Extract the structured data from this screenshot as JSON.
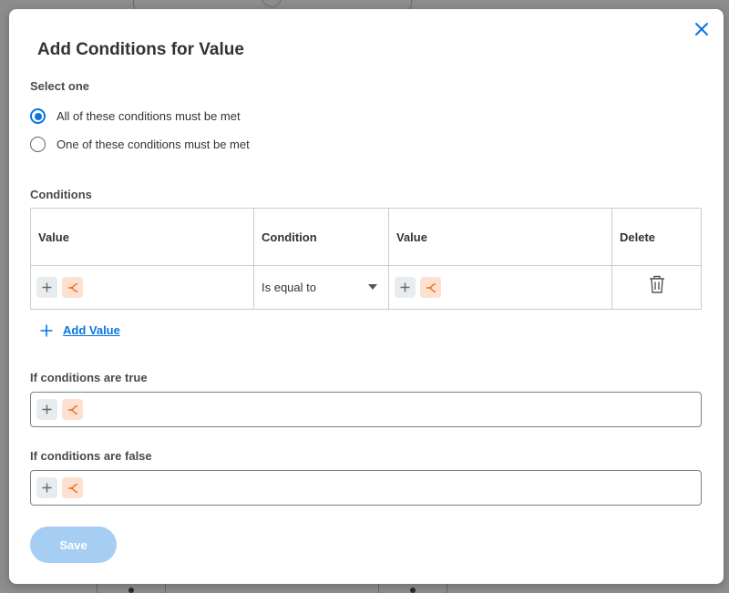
{
  "dialog": {
    "title": "Add Conditions for Value",
    "close_icon": "close-icon",
    "select_one_label": "Select one",
    "radio_options": [
      {
        "label": "All of these conditions must be met",
        "checked": true
      },
      {
        "label": "One of these conditions must be met",
        "checked": false
      }
    ],
    "conditions_label": "Conditions",
    "table": {
      "headers": [
        "Value",
        "Condition",
        "Value",
        "Delete"
      ],
      "rows": [
        {
          "condition": "Is equal to"
        }
      ]
    },
    "add_value_label": "Add Value",
    "if_true_label": "If conditions are true",
    "if_false_label": "If conditions are false",
    "save_label": "Save"
  },
  "colors": {
    "accent": "#0875e1",
    "prompt_chip": "#fde0cf",
    "prompt_icon": "#f0701b",
    "save_disabled": "#a6cdf2"
  }
}
